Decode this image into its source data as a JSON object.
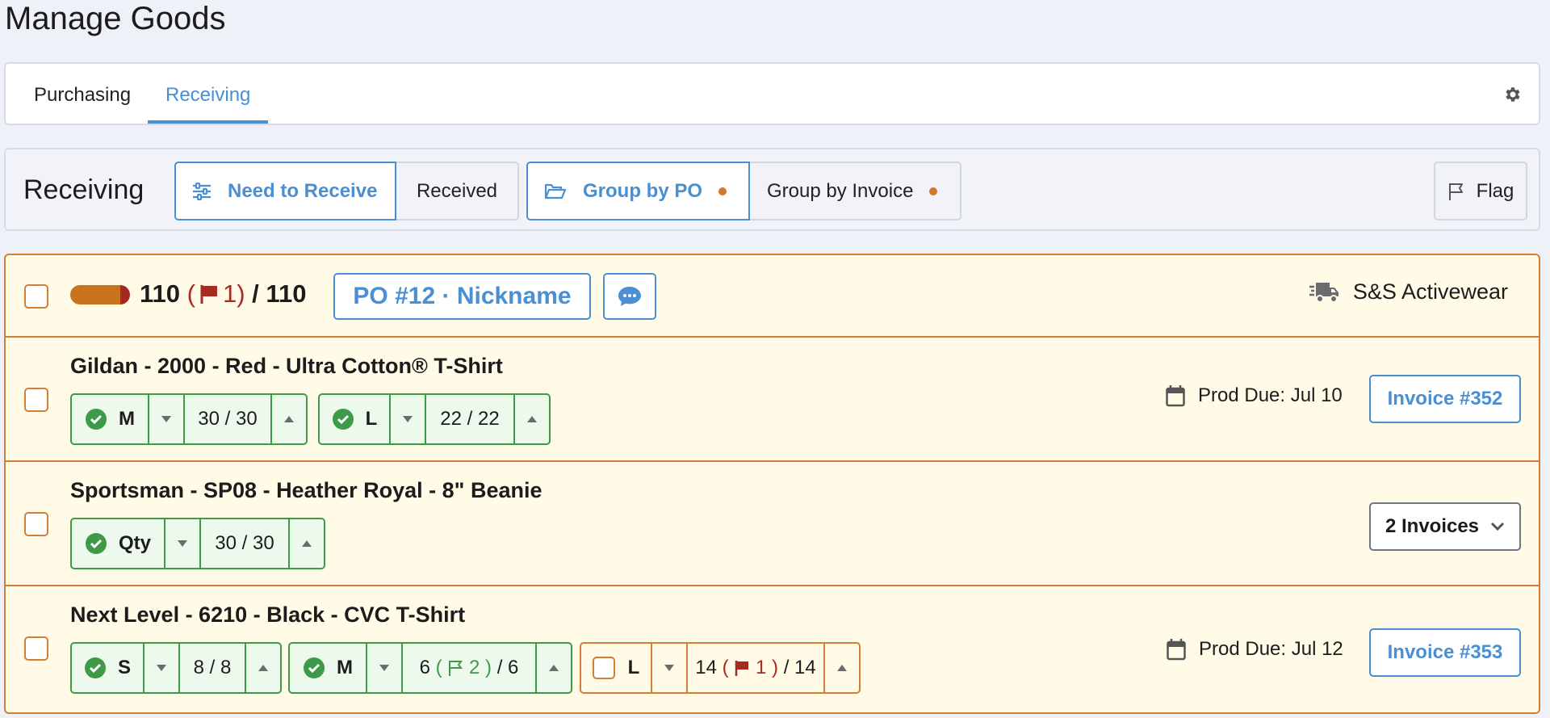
{
  "page": {
    "title": "Manage Goods"
  },
  "tabs": [
    {
      "label": "Purchasing",
      "active": false
    },
    {
      "label": "Receiving",
      "active": true
    }
  ],
  "toolbar": {
    "title": "Receiving",
    "need_to_receive": "Need to Receive",
    "received": "Received",
    "group_by_po": "Group by PO",
    "group_by_invoice": "Group by Invoice",
    "flag": "Flag"
  },
  "po_group": {
    "progress_fraction": 1.0,
    "received_count": "110",
    "flag_open": "(",
    "flagged_count": "1",
    "flag_close": ")",
    "separator": "/",
    "total_count": "110",
    "po_label": "PO #12 · Nickname",
    "vendor": "S&S Activewear",
    "items": [
      {
        "title": "Gildan - 2000 - Red - Ultra Cotton® T-Shirt",
        "variants": [
          {
            "size": "M",
            "qty": "30 / 30"
          },
          {
            "size": "L",
            "qty": "22 / 22"
          }
        ],
        "prod_due": "Prod Due: Jul 10",
        "invoice": "Invoice #352"
      },
      {
        "title": "Sportsman - SP08 - Heather Royal - 8\" Beanie",
        "variants": [
          {
            "size": "Qty",
            "qty": "30 / 30"
          }
        ],
        "invoice": "2 Invoices"
      },
      {
        "title": "Next Level - 6210 - Black - CVC T-Shirt",
        "variants": [
          {
            "size": "S",
            "qty": "8 / 8"
          },
          {
            "size": "M",
            "qty_prefix": "6",
            "flag_open": "(",
            "flag_count": "2",
            "flag_close": ")",
            "qty_suffix": "/ 6"
          },
          {
            "size": "L",
            "qty_prefix": "14",
            "flag_open": "(",
            "flag_count": "1",
            "flag_close": ")",
            "qty_suffix": "/ 14"
          }
        ],
        "prod_due": "Prod Due: Jul 12",
        "invoice": "Invoice #353"
      }
    ]
  },
  "colors": {
    "accent": "#4a8fd4",
    "orange": "#d27f35",
    "green": "#3f9a47",
    "red": "#a82a20"
  }
}
